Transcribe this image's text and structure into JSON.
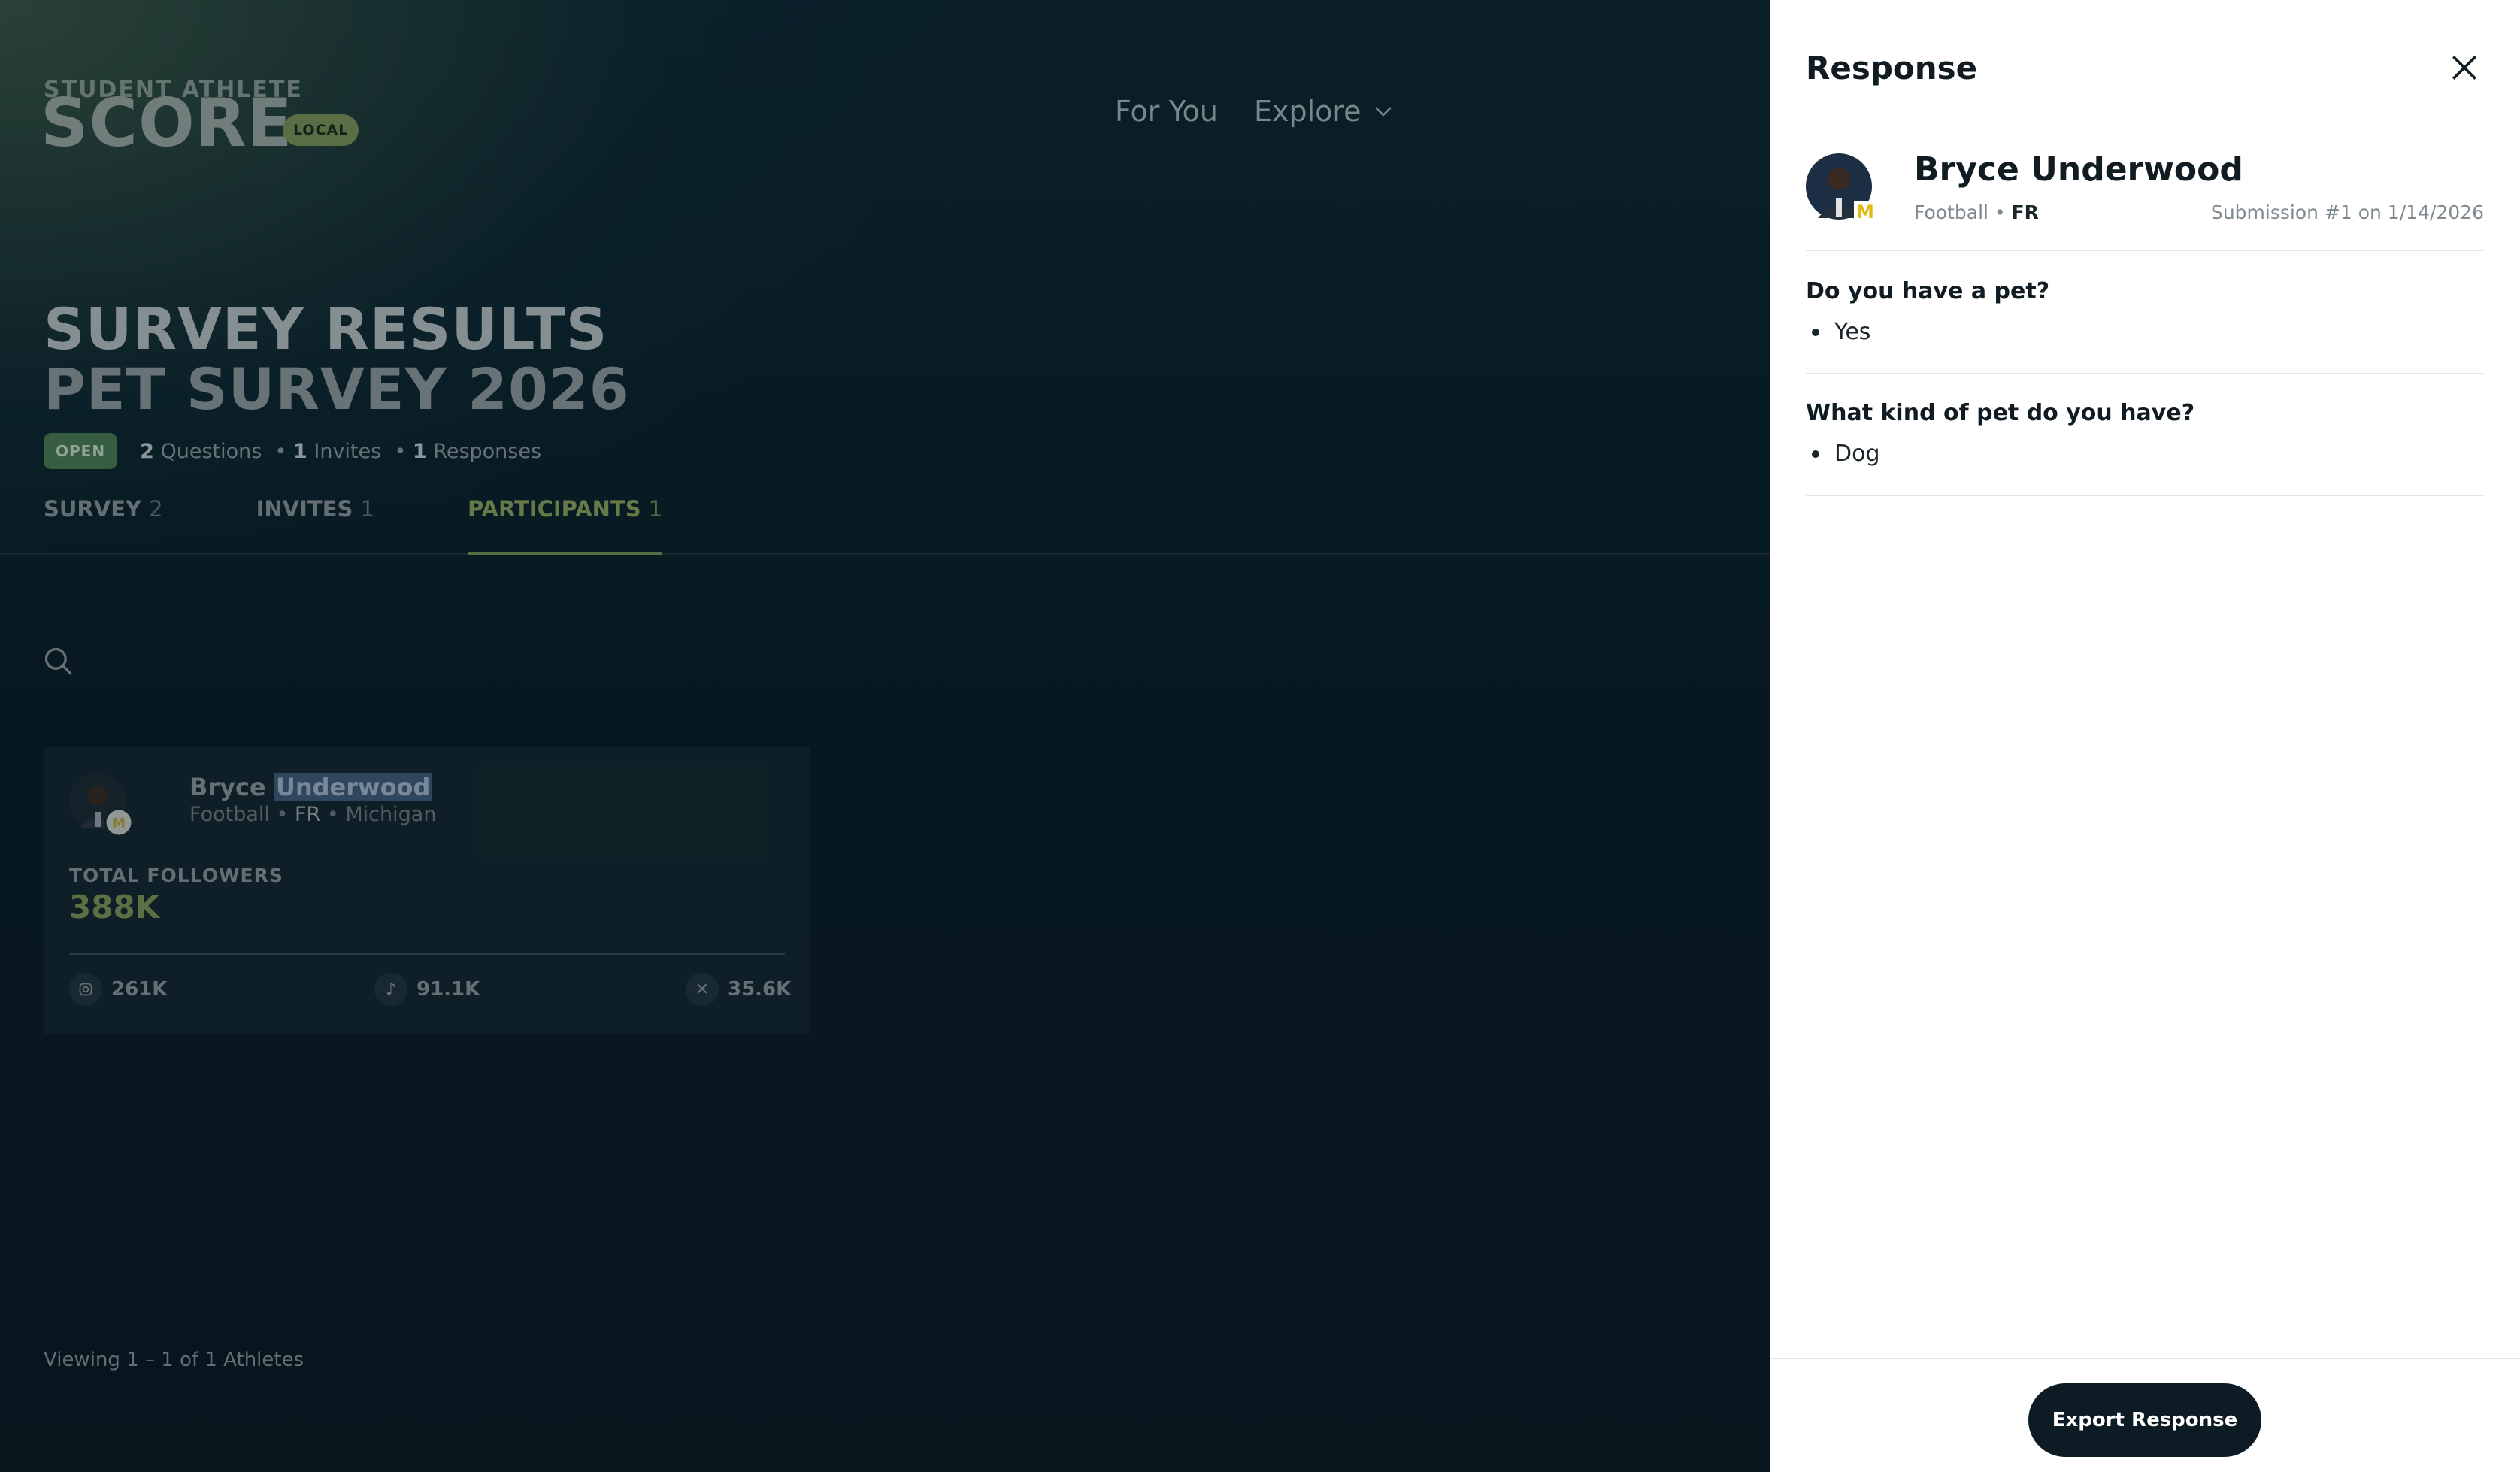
{
  "logo": {
    "top": "STUDENT ATHLETE",
    "main": "SCORE",
    "badge": "LOCAL"
  },
  "nav": {
    "for_you": "For You",
    "explore": "Explore"
  },
  "header": {
    "title_line1": "SURVEY RESULTS",
    "title_line2": "PET SURVEY 2026"
  },
  "meta": {
    "status": "OPEN",
    "questions_count": "2",
    "questions_label": "Questions",
    "invites_count": "1",
    "invites_label": "Invites",
    "responses_count": "1",
    "responses_label": "Responses"
  },
  "tabs": [
    {
      "label": "SURVEY",
      "count": "2"
    },
    {
      "label": "INVITES",
      "count": "1"
    },
    {
      "label": "PARTICIPANTS",
      "count": "1"
    }
  ],
  "participant_card": {
    "first_name": "Bryce",
    "last_name": "Underwood",
    "sport": "Football",
    "class": "FR",
    "school": "Michigan",
    "total_followers_label": "TOTAL FOLLOWERS",
    "total_followers": "388K",
    "instagram": "261K",
    "tiktok": "91.1K",
    "x": "35.6K"
  },
  "viewing": "Viewing 1 – 1 of 1 Athletes",
  "drawer": {
    "title": "Response",
    "name": "Bryce Underwood",
    "sport": "Football",
    "class": "FR",
    "submission": "Submission #1 on 1/14/2026",
    "responses": [
      {
        "question": "Do you have a pet?",
        "answer": "Yes"
      },
      {
        "question": "What kind of pet do you have?",
        "answer": "Dog"
      }
    ],
    "export_label": "Export Response"
  },
  "colors": {
    "accent": "#7b9456",
    "drawer_bg": "#ffffff",
    "button_bg": "#0d1b24"
  }
}
